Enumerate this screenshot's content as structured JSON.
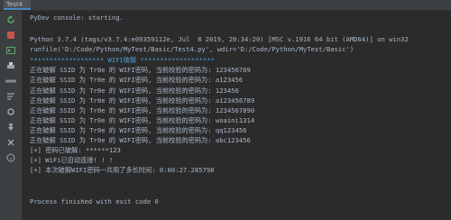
{
  "tab": {
    "label": "Test4"
  },
  "console": {
    "lines": [
      "PyDev console: starting.",
      "",
      "Python 3.7.4 (tags/v3.7.4:e09359112e, Jul  8 2019, 20:34:20) [MSC v.1916 64 bit (AMD64)] on win32",
      "runfile('D:/Code/Python/MyTest/Basic/Test4.py', wdir='D:/Code/Python/MyTest/Basic')",
      "******************* WIFI破解 *******************",
      "正在破解 SSID 为 Tr0e 的 WIFI密码, 当前校验的密码为: 123456789",
      "正在破解 SSID 为 Tr0e 的 WIFI密码, 当前校验的密码为: a123456",
      "正在破解 SSID 为 Tr0e 的 WIFI密码, 当前校验的密码为: 123456",
      "正在破解 SSID 为 Tr0e 的 WIFI密码, 当前校验的密码为: a123456789",
      "正在破解 SSID 为 Tr0e 的 WIFI密码, 当前校验的密码为: 1234567890",
      "正在破解 SSID 为 Tr0e 的 WIFI密码, 当前校验的密码为: woaini1314",
      "正在破解 SSID 为 Tr0e 的 WIFI密码, 当前校验的密码为: qq123456",
      "正在破解 SSID 为 Tr0e 的 WIFI密码, 当前校验的密码为: abc123456",
      "[+] 密码已破解: ******123",
      "[+] WiFi已自动连接! ! !",
      "[+] 本次破解WIFI密码一共用了多长时间: 0:00:27.285798",
      "",
      "",
      "Process finished with exit code 0"
    ]
  },
  "gutter": {
    "icons": [
      "rerun-icon",
      "stop-icon",
      "python-console-icon",
      "print-icon",
      "infinity-icon",
      "soft-wrap-icon",
      "settings-icon",
      "pin-icon",
      "close-icon",
      "help-icon"
    ]
  },
  "colors": {
    "background": "#2b2b2b",
    "text": "#a9b7c6",
    "gutter": "#3c3f41"
  }
}
